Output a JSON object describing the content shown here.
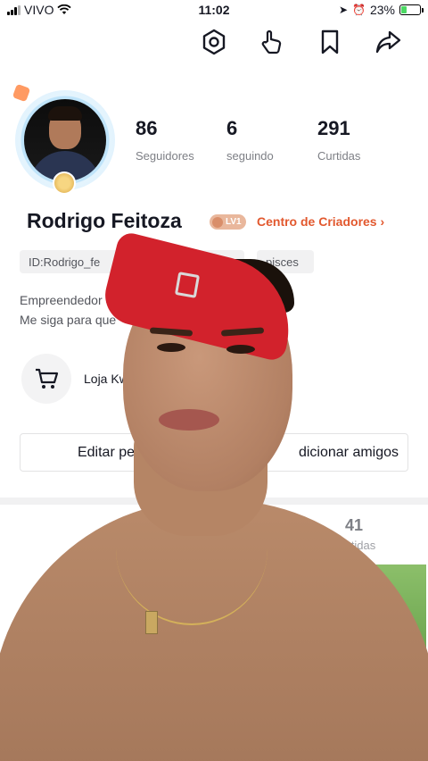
{
  "status_bar": {
    "carrier": "VIVO",
    "time": "11:02",
    "battery": "23%"
  },
  "profile": {
    "name": "Rodrigo Feitoza",
    "level_badge": "LV1",
    "creator_center": "Centro de Criadores ›",
    "stats": [
      {
        "value": "86",
        "label": "Seguidores"
      },
      {
        "value": "6",
        "label": "seguindo"
      },
      {
        "value": "291",
        "label": "Curtidas"
      }
    ],
    "chips": {
      "id": "ID:Rodrigo_fe",
      "gender_icon": "♂",
      "zodiac": "pisces"
    },
    "bio": {
      "line1": "Empreendedor e c",
      "line2": "Me siga para que"
    },
    "shop_label": "Loja Kw",
    "buttons": {
      "edit": "Editar pe",
      "add_friends": "dicionar amigos"
    }
  },
  "tabs": {
    "likes_count": "41",
    "likes_label": "Curtidas"
  },
  "icons": {
    "settings": "gear-icon",
    "like_hand": "hand-pointer-icon",
    "bookmark": "bookmark-icon",
    "share": "share-icon",
    "cart": "cart-icon"
  },
  "colors": {
    "accent": "#e2582e",
    "text": "#161823",
    "muted": "#7d7f85"
  }
}
